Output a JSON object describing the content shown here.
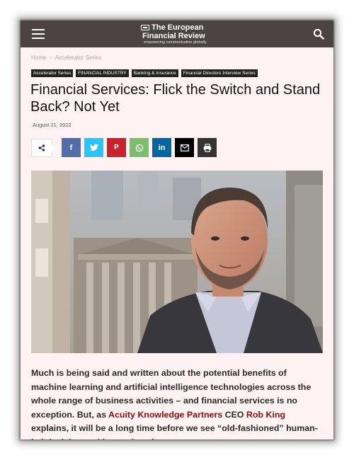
{
  "site": {
    "logo_line1": "The European",
    "logo_line2": "Financial Review",
    "logo_tagline": "empowering communication globally"
  },
  "breadcrumb": {
    "home": "Home",
    "separator": "›",
    "section": "Accelerator Series"
  },
  "tags": [
    "Accelerator Series",
    "FINANCIAL INDUSTRY",
    "Banking & Insurance",
    "Financial Directors Interview Series"
  ],
  "article": {
    "title": "Financial Services: Flick the Switch and Stand Back? Not Yet",
    "date": "August 21, 2022",
    "body_part1": "Much is being said and written about the potential benefits of machine learning and artificial intelligence technologies across the whole range of business activities – and financial services is no exception. But, as ",
    "link1": "Acuity Knowledge Partners",
    "body_part2": " CEO ",
    "link2": "Rob King",
    "body_part3": " explains, it will be a long time before we see “old-fashioned” human-led decision-making replaced."
  },
  "share": {
    "buttons": [
      {
        "name": "facebook",
        "color": "#516eab"
      },
      {
        "name": "twitter",
        "color": "#29c5f6"
      },
      {
        "name": "pinterest",
        "color": "#ca212a"
      },
      {
        "name": "whatsapp",
        "color": "#7bbf6a"
      },
      {
        "name": "linkedin",
        "color": "#0266a0"
      },
      {
        "name": "email",
        "color": "#000000"
      },
      {
        "name": "print",
        "color": "#333333"
      }
    ]
  },
  "colors": {
    "topbar": "#4a4342",
    "page_bg": "#fff2f2",
    "link": "#8b0d0d"
  }
}
